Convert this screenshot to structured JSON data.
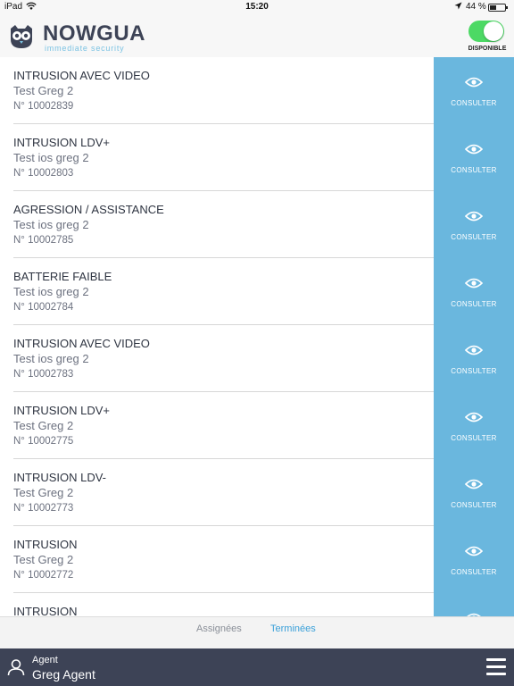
{
  "status_bar": {
    "carrier": "iPad",
    "time": "15:20",
    "battery": "44 %",
    "battery_level": 0.44
  },
  "header": {
    "brand": "NOWGUA",
    "tagline": "immediate security",
    "toggle_label": "DISPONIBLE",
    "toggle_on": true
  },
  "alerts": [
    {
      "title": "INTRUSION AVEC VIDEO",
      "subtitle": "Test Greg 2",
      "number": "N° 10002839",
      "action": "CONSULTER"
    },
    {
      "title": "INTRUSION LDV+",
      "subtitle": "Test ios greg 2",
      "number": "N° 10002803",
      "action": "CONSULTER"
    },
    {
      "title": "AGRESSION / ASSISTANCE",
      "subtitle": "Test ios greg 2",
      "number": "N° 10002785",
      "action": "CONSULTER"
    },
    {
      "title": "BATTERIE FAIBLE",
      "subtitle": "Test ios greg 2",
      "number": "N° 10002784",
      "action": "CONSULTER"
    },
    {
      "title": "INTRUSION AVEC VIDEO",
      "subtitle": "Test ios greg 2",
      "number": "N° 10002783",
      "action": "CONSULTER"
    },
    {
      "title": "INTRUSION LDV+",
      "subtitle": "Test Greg 2",
      "number": "N° 10002775",
      "action": "CONSULTER"
    },
    {
      "title": "INTRUSION LDV-",
      "subtitle": "Test Greg 2",
      "number": "N° 10002773",
      "action": "CONSULTER"
    },
    {
      "title": "INTRUSION",
      "subtitle": "Test Greg 2",
      "number": "N° 10002772",
      "action": "CONSULTER"
    },
    {
      "title": "INTRUSION",
      "subtitle": "",
      "number": "",
      "action": ""
    }
  ],
  "tabs": {
    "assigned": "Assignées",
    "done": "Terminées",
    "active": "done"
  },
  "footer": {
    "role": "Agent",
    "name": "Greg Agent"
  },
  "colors": {
    "accent": "#6ab7de",
    "footer": "#3d4356",
    "toggle": "#4cd964",
    "active_tab": "#3aa0d9"
  }
}
